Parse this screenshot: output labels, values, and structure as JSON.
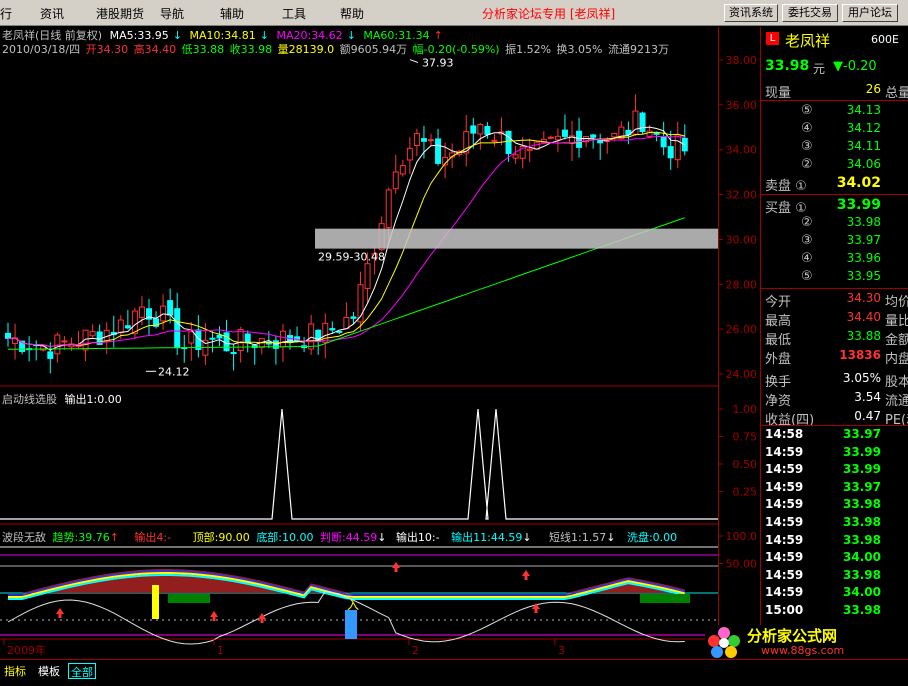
{
  "menubar": {
    "items": [
      "行",
      "资讯",
      "港股期货",
      "导航",
      "辅助",
      "工具",
      "帮助"
    ],
    "forum_title": "分析家论坛专用 [老凤祥]",
    "buttons": [
      "资讯系统",
      "委托交易",
      "用户论坛"
    ]
  },
  "main_chart": {
    "title": "老凤祥(日线 前复权)",
    "ma5": "MA5:33.95",
    "ma10": "MA10:34.81",
    "ma20": "MA20:34.62",
    "ma60": "MA60:31.34",
    "info": {
      "date": "2010/03/18/四",
      "open": "开34.30",
      "high": "高34.40",
      "low": "低33.88",
      "close": "收33.98",
      "volume": "量28139.0",
      "amount": "额9605.94万",
      "change": "幅-0.20(-0.59%)",
      "amplitude": "振1.52%",
      "turnover": "换3.05%",
      "float": "流通9213万"
    },
    "high_label": "37.93",
    "low_label": "24.12",
    "box_label": "29.59-30.48",
    "y_ticks": [
      "38.00",
      "36.00",
      "34.00",
      "32.00",
      "30.00",
      "28.00",
      "26.00",
      "24.00"
    ]
  },
  "panel2": {
    "title": "启动线选股",
    "output": "输出1:0.00",
    "y_ticks": [
      "1.00",
      "0.75",
      "0.50",
      "0.25"
    ]
  },
  "panel3": {
    "title": "波段无敌",
    "trend": "趋势:39.76",
    "out4": "输出4:-",
    "top": "顶部:90.00",
    "bottom": "底部:10.00",
    "judge": "判断:44.59",
    "out10": "输出10:-",
    "out11": "输出11:44.59",
    "short": "短线1:1.57",
    "wash": "洗盘:0.00",
    "y_ticks": [
      "100.0",
      "50.00"
    ],
    "buy_label": "入"
  },
  "x_axis": {
    "labels": [
      "2009年",
      "1",
      "2",
      "3"
    ]
  },
  "quote": {
    "name": "老凤祥",
    "code": "600E",
    "price": "33.98",
    "price_unit": "元",
    "change": "▼-0.20",
    "now_label": "现量",
    "now_val": "26",
    "total_label": "总量",
    "sell": [
      {
        "label": "⑤",
        "val": "34.13"
      },
      {
        "label": "④",
        "val": "34.12"
      },
      {
        "label": "③",
        "val": "34.11"
      },
      {
        "label": "②",
        "val": "34.06"
      },
      {
        "label": "卖盘 ①",
        "val": "34.02"
      }
    ],
    "buy": [
      {
        "label": "买盘 ①",
        "val": "33.99"
      },
      {
        "label": "②",
        "val": "33.98"
      },
      {
        "label": "③",
        "val": "33.97"
      },
      {
        "label": "④",
        "val": "33.96"
      },
      {
        "label": "⑤",
        "val": "33.95"
      }
    ],
    "stats": [
      {
        "label": "今开",
        "val": "34.30",
        "tail": "均价"
      },
      {
        "label": "最高",
        "val": "34.40",
        "tail": "量比"
      },
      {
        "label": "最低",
        "val": "33.88",
        "tail": "金额"
      },
      {
        "label": "外盘",
        "val": "13836",
        "tail": "内盘"
      },
      {
        "label": "换手",
        "val": "3.05%",
        "tail": "股本"
      },
      {
        "label": "净资",
        "val": "3.54",
        "tail": "流通"
      },
      {
        "label": "收益(四)",
        "val": "0.47",
        "tail": "PE(动"
      }
    ],
    "ticks": [
      {
        "time": "14:58",
        "price": "33.97"
      },
      {
        "time": "14:59",
        "price": "33.99"
      },
      {
        "time": "14:59",
        "price": "33.99"
      },
      {
        "time": "14:59",
        "price": "33.97"
      },
      {
        "time": "14:59",
        "price": "33.98"
      },
      {
        "time": "14:59",
        "price": "33.98"
      },
      {
        "time": "14:59",
        "price": "33.98"
      },
      {
        "time": "14:59",
        "price": "34.00"
      },
      {
        "time": "14:59",
        "price": "33.98"
      },
      {
        "time": "14:59",
        "price": "34.00"
      },
      {
        "time": "15:00",
        "price": "33.98"
      }
    ]
  },
  "tabs": [
    "指标",
    "模板",
    "全部"
  ],
  "watermark": {
    "brand": "分析家公式网",
    "url": "www.88gs.com"
  },
  "colors": {
    "up": "#ff3232",
    "down": "#00ffff",
    "ma5": "#ffffff",
    "ma10": "#ffff00",
    "ma20": "#ff00ff",
    "ma60": "#00ff00",
    "price_green": "#00ff00",
    "price_red": "#ff3232"
  }
}
